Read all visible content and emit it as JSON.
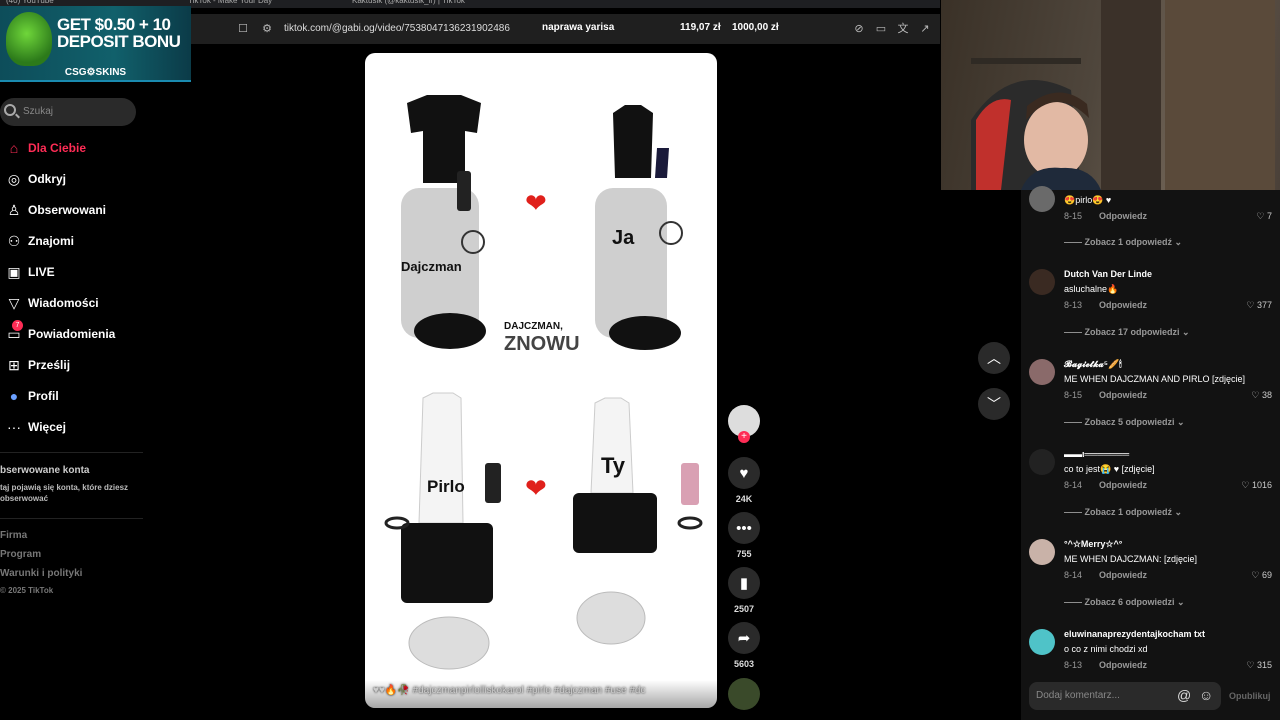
{
  "browser": {
    "tabs": [
      "(40) YouTube",
      "TikTok - Make Your Day",
      "Kaktusik (@kaktusik_ir) | TikTok"
    ],
    "url": "tiktok.com/@gabi.og/video/7538047136231902486",
    "stream_overlay": {
      "goal_text": "naprawa yarisa",
      "current": "119,07 zł",
      "target": "1000,00 zł"
    }
  },
  "ad": {
    "headline_1": "GET $0.50 + 10",
    "headline_2": "DEPOSIT BONU",
    "brand": "CSG⚙SKINS"
  },
  "sidebar": {
    "search_placeholder": "Szukaj",
    "items": [
      {
        "label": "Dla Ciebie",
        "icon": "home-icon"
      },
      {
        "label": "Odkryj",
        "icon": "compass-icon"
      },
      {
        "label": "Obserwowani",
        "icon": "user-follow-icon"
      },
      {
        "label": "Znajomi",
        "icon": "friends-icon"
      },
      {
        "label": "LIVE",
        "icon": "live-icon"
      },
      {
        "label": "Wiadomości",
        "icon": "send-icon"
      },
      {
        "label": "Powiadomienia",
        "icon": "bell-icon",
        "badge": "7"
      },
      {
        "label": "Prześlij",
        "icon": "upload-icon"
      },
      {
        "label": "Profil",
        "icon": "profile-icon"
      },
      {
        "label": "Więcej",
        "icon": "more-icon"
      }
    ],
    "followed_heading": "bserwowane konta",
    "followed_desc": "tąj pojawią się konta, które dziesz obserwować",
    "footer": [
      "Firma",
      "Program",
      "Warunki i polityki",
      "© 2025 TikTok"
    ]
  },
  "video": {
    "labels": {
      "top_left": "Dajczman",
      "top_right": "Ja",
      "center_1": "DAJCZMAN,",
      "center_2": "ZNOWU",
      "bottom_left": "Pirlo",
      "bottom_right": "Ty"
    },
    "caption": "♥♥🔥🥀 #dajczmanpirloiliskokarol #pirlo #dajczman #use #dc"
  },
  "actions": {
    "likes": "24K",
    "comments": "755",
    "saves": "2507",
    "shares": "5603"
  },
  "comments": [
    {
      "user": "",
      "text": "😍pirlo😍 ♥",
      "date": "8-15",
      "reply": "Odpowiedz",
      "likes": "7",
      "more": "Zobacz 1 odpowiedź"
    },
    {
      "user": "Dutch Van Der Linde",
      "text": "asluchalne🔥",
      "date": "8-13",
      "reply": "Odpowiedz",
      "likes": "377",
      "more": "Zobacz 17 odpowiedzi"
    },
    {
      "user": "𝓑𝓪𝓰𝓲𝓮𝓽𝓴𝓪⁵🥖🕯",
      "text": "ME WHEN DAJCZMAN AND PIRLO [zdjęcie]",
      "date": "8-15",
      "reply": "Odpowiedz",
      "likes": "38",
      "more": "Zobacz 5 odpowiedzi"
    },
    {
      "user": "▬▬ι═══════",
      "text": "co to jest😭 ♥ [zdjęcie]",
      "date": "8-14",
      "reply": "Odpowiedz",
      "likes": "1016",
      "more": "Zobacz 1 odpowiedź"
    },
    {
      "user": "°^☆Merry☆^°",
      "text": "ME WHEN DAJCZMAN: [zdjęcie]",
      "date": "8-14",
      "reply": "Odpowiedz",
      "likes": "69",
      "more": "Zobacz 6 odpowiedzi"
    },
    {
      "user": "eluwinanaprezydentajkocham txt",
      "text": "o co z nimi chodzi xd",
      "date": "8-13",
      "reply": "Odpowiedz",
      "likes": "315",
      "more": ""
    }
  ],
  "comment_box": {
    "placeholder": "Dodaj komentarz...",
    "publish": "Opublikuj"
  },
  "colors": {
    "accent": "#fe2c55",
    "background": "#000000",
    "panel": "#121212"
  }
}
